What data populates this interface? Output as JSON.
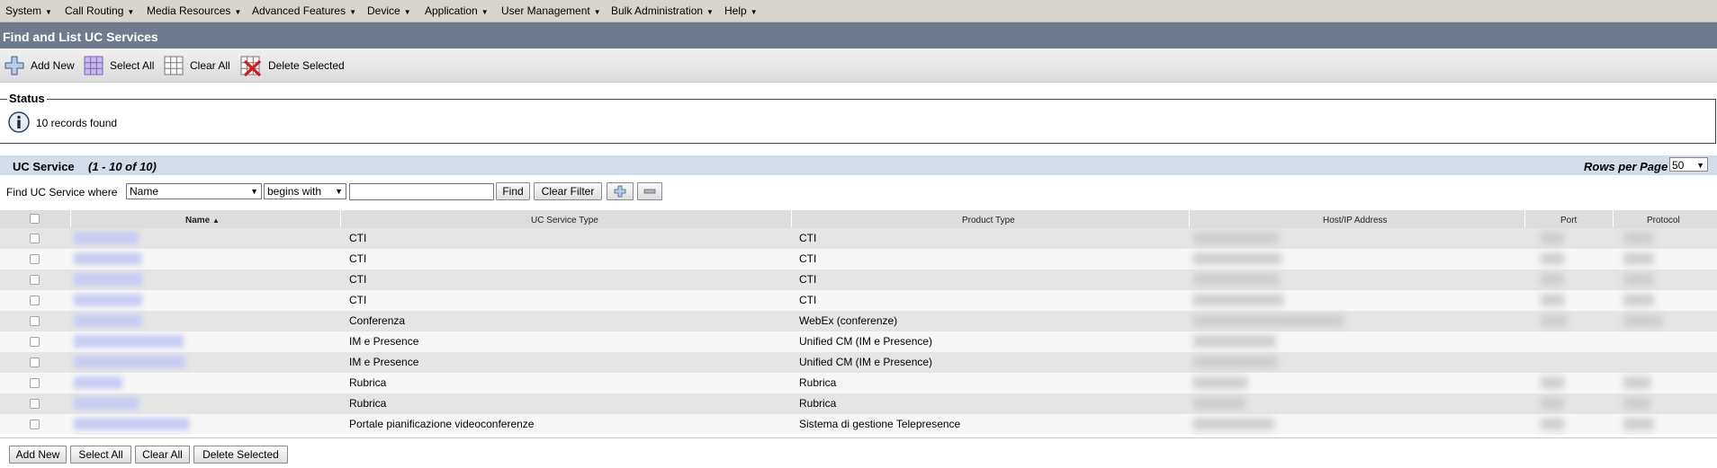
{
  "menu": [
    {
      "label": "System"
    },
    {
      "label": "Call Routing"
    },
    {
      "label": "Media Resources"
    },
    {
      "label": "Advanced Features"
    },
    {
      "label": "Device"
    },
    {
      "label": "Application"
    },
    {
      "label": "User Management"
    },
    {
      "label": "Bulk Administration"
    },
    {
      "label": "Help"
    }
  ],
  "page_title": "Find and List UC Services",
  "toolbar": {
    "add_new": "Add New",
    "select_all": "Select All",
    "clear_all": "Clear All",
    "delete_selected": "Delete Selected"
  },
  "status": {
    "legend": "Status",
    "message": "10 records found"
  },
  "section": {
    "title": "UC Service",
    "count": "(1 - 10 of 10)",
    "rows_per_page_label": "Rows per Page",
    "rows_per_page_value": "50"
  },
  "search": {
    "label": "Find UC Service where",
    "field": "Name",
    "operator": "begins with",
    "value": "",
    "find_button": "Find",
    "clear_filter_button": "Clear Filter"
  },
  "table": {
    "columns": {
      "name": "Name",
      "service_type": "UC Service Type",
      "product_type": "Product Type",
      "host": "Host/IP Address",
      "port": "Port",
      "protocol": "Protocol"
    },
    "rows": [
      {
        "service_type": "CTI",
        "product_type": "CTI"
      },
      {
        "service_type": "CTI",
        "product_type": "CTI"
      },
      {
        "service_type": "CTI",
        "product_type": "CTI"
      },
      {
        "service_type": "CTI",
        "product_type": "CTI"
      },
      {
        "service_type": "Conferenza",
        "product_type": "WebEx (conferenze)"
      },
      {
        "service_type": "IM e Presence",
        "product_type": "Unified CM (IM e Presence)"
      },
      {
        "service_type": "IM e Presence",
        "product_type": "Unified CM (IM e Presence)"
      },
      {
        "service_type": "Rubrica",
        "product_type": "Rubrica"
      },
      {
        "service_type": "Rubrica",
        "product_type": "Rubrica"
      },
      {
        "service_type": "Portale pianificazione videoconferenze",
        "product_type": "Sistema di gestione Telepresence"
      }
    ]
  },
  "bottom_buttons": {
    "add_new": "Add New",
    "select_all": "Select All",
    "clear_all": "Clear All",
    "delete_selected": "Delete Selected"
  },
  "colors": {
    "title_bar": "#6d7b8d",
    "menu_bar": "#d8d5cf",
    "section_bar": "#d3dce9",
    "row_odd": "#e5e5e5",
    "row_even": "#f7f7f7"
  },
  "icons": [
    "add-icon",
    "select-all-grid-icon",
    "clear-all-grid-icon",
    "delete-grid-icon",
    "info-icon",
    "sort-ascending-icon",
    "plus-icon",
    "minus-icon"
  ]
}
